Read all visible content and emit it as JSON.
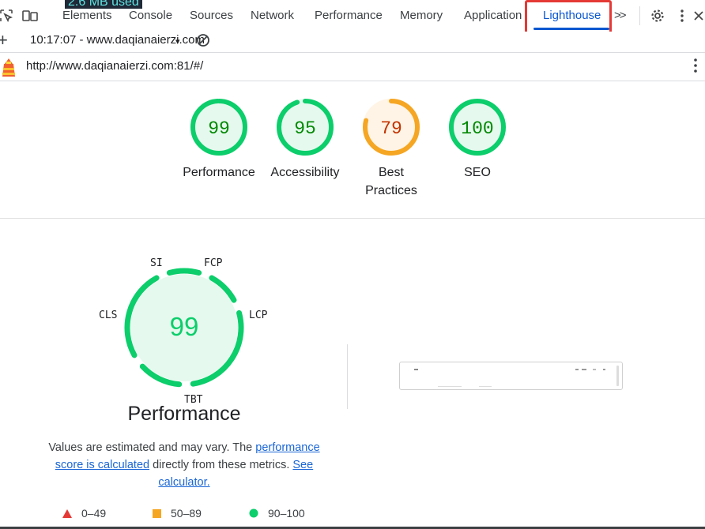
{
  "devtools": {
    "tabs": [
      "Elements",
      "Console",
      "Sources",
      "Network",
      "Performance",
      "Memory",
      "Application",
      "Lighthouse"
    ],
    "active_tab": "Lighthouse",
    "overflow_label": ">>",
    "overlay_partial_text": "2.6 MB used"
  },
  "toolbar": {
    "report_label": "10:17:07 - www.daqianaierzi.com",
    "dropdown_glyph": "▾"
  },
  "page": {
    "url": "http://www.daqianaierzi.com:81/#/"
  },
  "scores": [
    {
      "value": "99",
      "label_line1": "Performance",
      "label_line2": "",
      "status": "pass",
      "fraction": 0.99
    },
    {
      "value": "95",
      "label_line1": "Accessibility",
      "label_line2": "",
      "status": "pass",
      "fraction": 0.95
    },
    {
      "value": "79",
      "label_line1": "Best",
      "label_line2": "Practices",
      "status": "average",
      "fraction": 0.79
    },
    {
      "value": "100",
      "label_line1": "SEO",
      "label_line2": "",
      "status": "pass",
      "fraction": 1.0
    }
  ],
  "performance": {
    "score": "99",
    "title": "Performance",
    "metrics": [
      "SI",
      "FCP",
      "LCP",
      "TBT",
      "CLS"
    ],
    "description_pre": "Values are estimated and may vary. The ",
    "description_link1": "performance score is calculated",
    "description_mid": " directly from these metrics. ",
    "description_link2": "See calculator."
  },
  "legend": [
    {
      "range": "0–49",
      "shape": "triangle",
      "color": "#e53935"
    },
    {
      "range": "50–89",
      "shape": "square",
      "color": "#f5a623"
    },
    {
      "range": "90–100",
      "shape": "circle",
      "color": "#0cce6b"
    }
  ],
  "colors": {
    "pass": "#0cce6b",
    "pass_text": "#008800",
    "average": "#f5a623",
    "average_text": "#c33300",
    "fail": "#e53935",
    "accent": "#0b57d0"
  }
}
